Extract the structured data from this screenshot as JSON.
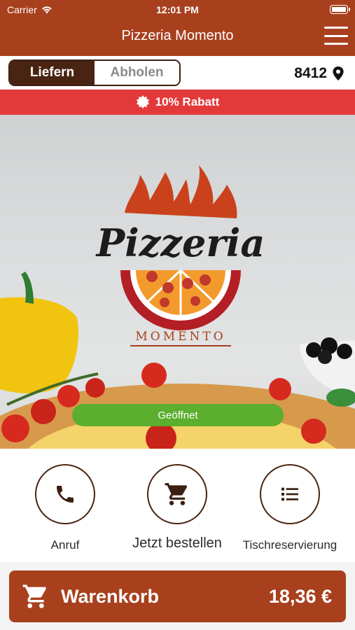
{
  "status": {
    "carrier": "Carrier",
    "time": "12:01 PM"
  },
  "header": {
    "title": "Pizzeria Momento"
  },
  "mode": {
    "deliver": "Liefern",
    "pickup": "Abholen",
    "selected": "Liefern"
  },
  "location": {
    "zip": "8412"
  },
  "promo": {
    "text": "10% Rabatt"
  },
  "hero": {
    "logo_word": "Pizzeria",
    "logo_sub": "MOMENTO",
    "open_status": "Geöffnet",
    "colors": {
      "flame": "#c9421c",
      "ring": "#b31f24",
      "open": "#5cae2e"
    }
  },
  "actions": [
    {
      "label": "Anruf",
      "icon": "phone-icon"
    },
    {
      "label": "Jetzt bestellen",
      "icon": "cart-icon"
    },
    {
      "label": "Tischreservierung",
      "icon": "list-icon"
    }
  ],
  "cart": {
    "label": "Warenkorb",
    "total": "18,36 €",
    "icon": "cart-icon"
  },
  "colors": {
    "brand": "#a8401e",
    "dark": "#4a2412",
    "promo": "#e4393a"
  }
}
